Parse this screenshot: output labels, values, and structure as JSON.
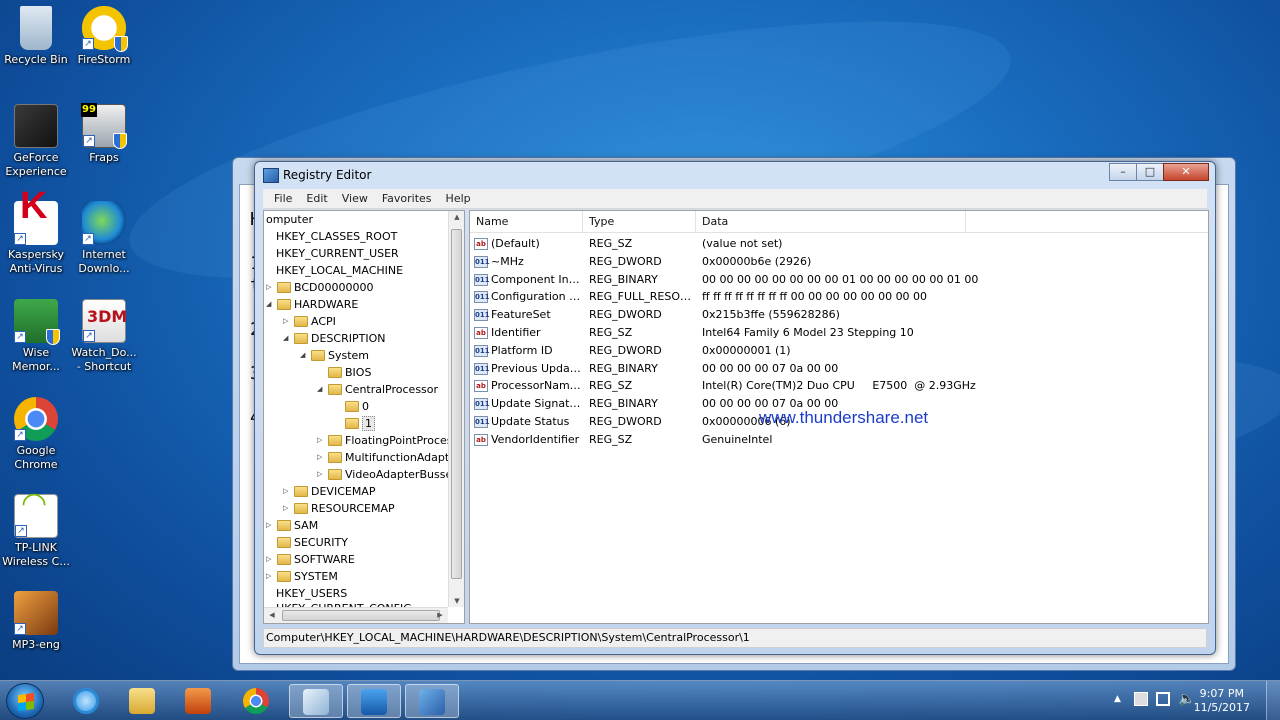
{
  "desktop_icons": [
    {
      "label": "Recycle Bin"
    },
    {
      "label": "FireStorm"
    },
    {
      "label": "GeForce Experience"
    },
    {
      "label": "Fraps"
    },
    {
      "label": "Kaspersky Anti-Virus"
    },
    {
      "label": "Internet Downlo..."
    },
    {
      "label": "Wise Memor..."
    },
    {
      "label": "Watch_Do... - Shortcut"
    },
    {
      "label": "Google Chrome"
    },
    {
      "label": "TP-LINK Wireless C..."
    },
    {
      "label": "MP3-eng"
    }
  ],
  "back_window": {
    "lines": [
      "H",
      "1",
      "t",
      "2",
      "3",
      "4"
    ]
  },
  "window": {
    "title": "Registry Editor",
    "minimize": "–",
    "maximize": "□",
    "close": "✕"
  },
  "menu": [
    "File",
    "Edit",
    "View",
    "Favorites",
    "Help"
  ],
  "tree": [
    {
      "label": "omputer"
    },
    {
      "label": "HKEY_CLASSES_ROOT"
    },
    {
      "label": "HKEY_CURRENT_USER"
    },
    {
      "label": "HKEY_LOCAL_MACHINE"
    },
    {
      "label": "BCD00000000"
    },
    {
      "label": "HARDWARE"
    },
    {
      "label": "ACPI"
    },
    {
      "label": "DESCRIPTION"
    },
    {
      "label": "System"
    },
    {
      "label": "BIOS"
    },
    {
      "label": "CentralProcessor"
    },
    {
      "label": "0"
    },
    {
      "label": "1"
    },
    {
      "label": "FloatingPointProces"
    },
    {
      "label": "MultifunctionAdapte"
    },
    {
      "label": "VideoAdapterBusses"
    },
    {
      "label": "DEVICEMAP"
    },
    {
      "label": "RESOURCEMAP"
    },
    {
      "label": "SAM"
    },
    {
      "label": "SECURITY"
    },
    {
      "label": "SOFTWARE"
    },
    {
      "label": "SYSTEM"
    },
    {
      "label": "HKEY_USERS"
    },
    {
      "label": "HKEY_CURRENT_CONFIG"
    }
  ],
  "columns": {
    "name": "Name",
    "type": "Type",
    "data": "Data"
  },
  "values": [
    {
      "name": "(Default)",
      "type": "REG_SZ",
      "data": "(value not set)",
      "icon": "ab"
    },
    {
      "name": "~MHz",
      "type": "REG_DWORD",
      "data": "0x00000b6e (2926)",
      "icon": "bin"
    },
    {
      "name": "Component Inf...",
      "type": "REG_BINARY",
      "data": "00 00 00 00 00 00 00 00 01 00 00 00 00 00 01 00",
      "icon": "bin"
    },
    {
      "name": "Configuration D...",
      "type": "REG_FULL_RESOU...",
      "data": "ff ff ff ff ff ff ff ff 00 00 00 00 00 00 00 00",
      "icon": "bin"
    },
    {
      "name": "FeatureSet",
      "type": "REG_DWORD",
      "data": "0x215b3ffe (559628286)",
      "icon": "bin"
    },
    {
      "name": "Identifier",
      "type": "REG_SZ",
      "data": "Intel64 Family 6 Model 23 Stepping 10",
      "icon": "ab"
    },
    {
      "name": "Platform ID",
      "type": "REG_DWORD",
      "data": "0x00000001 (1)",
      "icon": "bin"
    },
    {
      "name": "Previous Update...",
      "type": "REG_BINARY",
      "data": "00 00 00 00 07 0a 00 00",
      "icon": "bin"
    },
    {
      "name": "ProcessorName...",
      "type": "REG_SZ",
      "data": "Intel(R) Core(TM)2 Duo CPU     E7500  @ 2.93GHz",
      "icon": "ab"
    },
    {
      "name": "Update Signature",
      "type": "REG_BINARY",
      "data": "00 00 00 00 07 0a 00 00",
      "icon": "bin"
    },
    {
      "name": "Update Status",
      "type": "REG_DWORD",
      "data": "0x00000006 (6)",
      "icon": "bin"
    },
    {
      "name": "VendorIdentifier",
      "type": "REG_SZ",
      "data": "GenuineIntel",
      "icon": "ab"
    }
  ],
  "watermark": "www.thundershare.net",
  "status_path": "Computer\\HKEY_LOCAL_MACHINE\\HARDWARE\\DESCRIPTION\\System\\CentralProcessor\\1",
  "taskbar": {
    "time": "9:07 PM",
    "date": "11/5/2017"
  },
  "icon_names": [
    "recycle-bin-icon",
    "firestorm-icon",
    "geforce-icon",
    "fraps-icon",
    "kaspersky-icon",
    "idm-icon",
    "wise-memory-icon",
    "watch-dogs-icon",
    "chrome-icon",
    "tplink-icon",
    "mp3-icon"
  ]
}
